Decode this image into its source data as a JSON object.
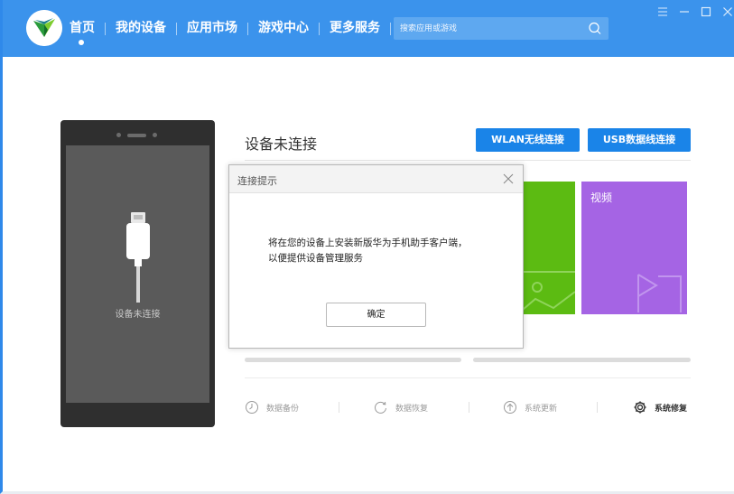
{
  "nav": {
    "items": [
      {
        "label": "首页"
      },
      {
        "label": "我的设备"
      },
      {
        "label": "应用市场"
      },
      {
        "label": "游戏中心"
      },
      {
        "label": "更多服务"
      }
    ],
    "active_index": 0
  },
  "search": {
    "placeholder": "搜索应用或游戏",
    "icon": "search-icon"
  },
  "window_controls": [
    "menu-icon",
    "minimize-icon",
    "maximize-icon",
    "close-icon"
  ],
  "phone": {
    "status": "设备未连接",
    "icon": "usb-cable-icon"
  },
  "device": {
    "title": "设备未连接",
    "wlan_button": "WLAN无线连接",
    "usb_button": "USB数据线连接"
  },
  "tiles": [
    {
      "label": "",
      "color": "#5cbb12"
    },
    {
      "label": "视频",
      "color": "#a564e4"
    }
  ],
  "tools": [
    {
      "label": "数据备份",
      "icon": "clock-icon"
    },
    {
      "label": "数据恢复",
      "icon": "refresh-icon"
    },
    {
      "label": "系统更新",
      "icon": "arrow-up-circle-icon"
    },
    {
      "label": "系统修复",
      "icon": "gear-icon"
    }
  ],
  "dialog": {
    "title": "连接提示",
    "message_line1": "将在您的设备上安装新版华为手机助手客户端，",
    "message_line2": "以便提供设备管理服务",
    "ok_label": "确定"
  },
  "colors": {
    "topbar": "#3b93ec",
    "accent_button": "#1a84e8",
    "tile_green": "#5cbb12",
    "tile_purple": "#a564e4"
  }
}
